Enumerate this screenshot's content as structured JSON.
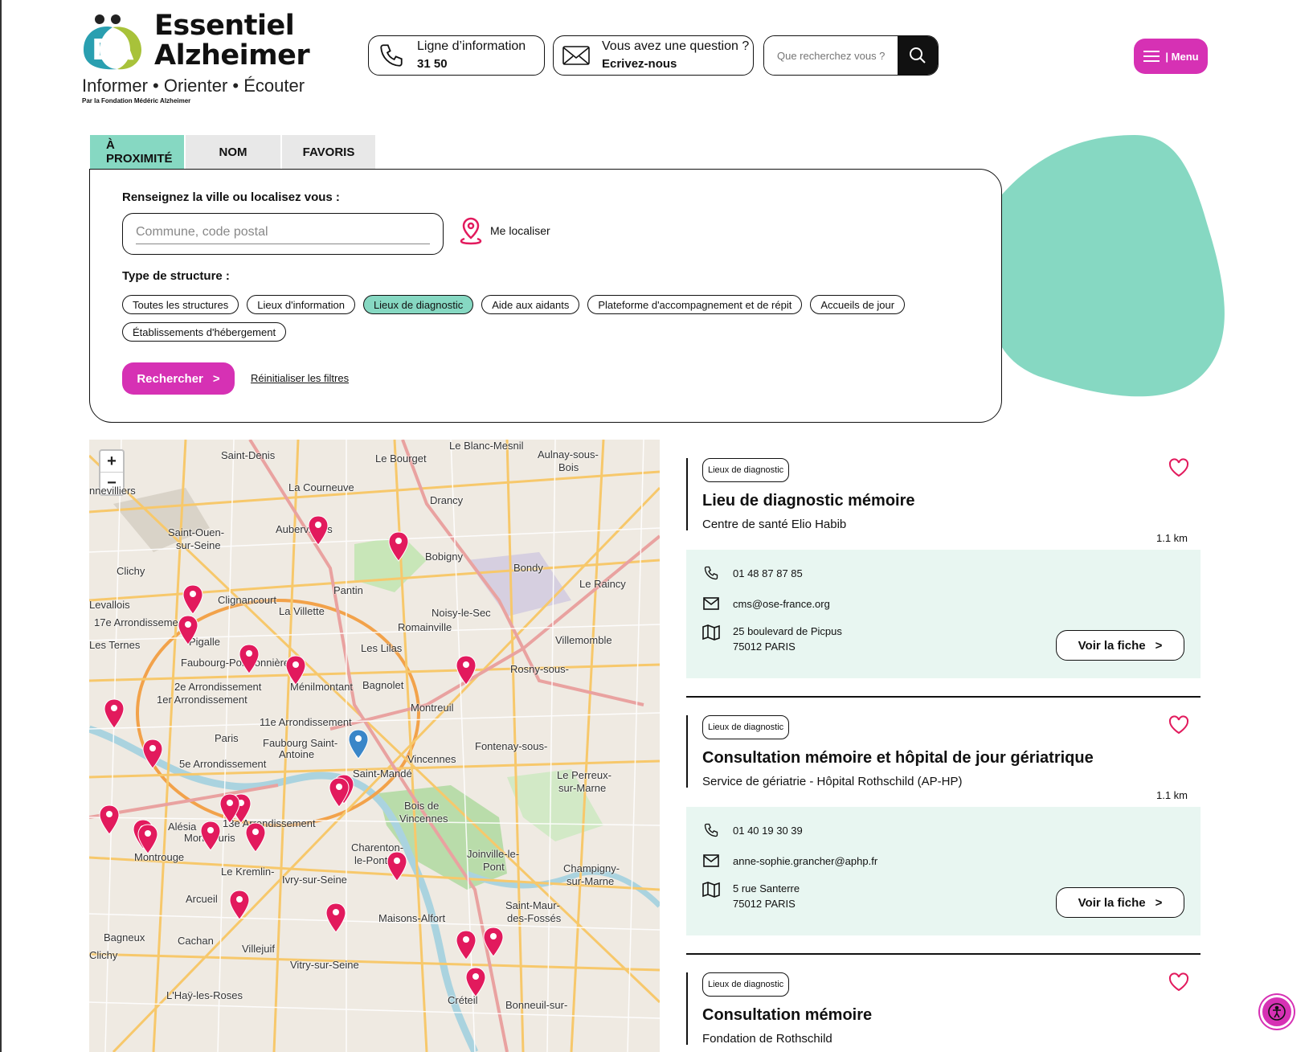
{
  "brand": {
    "title_line1": "Essentiel",
    "title_line2": "Alzheimer",
    "tagline": "Informer • Orienter • Écouter",
    "subline": "Par la Fondation Médéric Alzheimer",
    "colors": {
      "magenta": "#d631b4",
      "mint": "#86d8c2",
      "teal": "#2a9fb0",
      "green": "#a8c23a"
    }
  },
  "header": {
    "phone": {
      "line1": "Ligne d’information",
      "line2": "31 50",
      "icon": "phone-icon"
    },
    "contact": {
      "line1": "Vous avez une question ?",
      "line2": "Ecrivez-nous",
      "icon": "envelope-icon"
    },
    "search_placeholder": "Que recherchez vous ?",
    "menu_label": "| Menu"
  },
  "tabs": [
    "À PROXIMITÉ",
    "NOM",
    "FAVORIS"
  ],
  "form": {
    "city_label": "Renseignez la ville ou localisez vous :",
    "city_placeholder": "Commune, code postal",
    "locate_label": "Me localiser",
    "type_label": "Type de structure :",
    "chips": [
      {
        "label": "Toutes les structures",
        "active": false
      },
      {
        "label": "Lieux d'information",
        "active": false
      },
      {
        "label": "Lieux de diagnostic",
        "active": true
      },
      {
        "label": "Aide aux aidants",
        "active": false
      },
      {
        "label": "Plateforme d'accompagnement et de répit",
        "active": false
      },
      {
        "label": "Accueils de jour",
        "active": false
      },
      {
        "label": "Établissements d'hébergement",
        "active": false
      }
    ],
    "search_btn": "Rechercher",
    "reset_label": "Réinitialiser les filtres"
  },
  "map": {
    "zoom_in": "+",
    "zoom_out": "−",
    "places": [
      "Saint-Denis",
      "Le Blanc-Mesnil",
      "Aulnay-sous-",
      "Bois",
      "Le Bourget",
      "La Courneuve",
      "Drancy",
      "nnevilliers",
      "Aubervilliers",
      "Saint-Ouen-",
      "sur-Seine",
      "Bobigny",
      "Bondy",
      "Clichy",
      "Pantin",
      "Clignancourt",
      "La Villette",
      "Le Raincy",
      "17e Arrondissement",
      "Noisy-le-Sec",
      "Romainville",
      "Pigalle",
      "Les Lilas",
      "Villemomble",
      "Faubourg-Poissonnière",
      "Ménilmontant",
      "Bagnolet",
      "Rosny-sous-",
      "Montreuil",
      "2e Arrondissement",
      "1er Arrondissement",
      "11e Arrondissement",
      "Paris",
      "Faubourg Saint-",
      "Antoine",
      "Fontenay-sous-",
      "Vincennes",
      "5e Arrondissement",
      "Saint-Mandé",
      "Le Perreux-",
      "sur-Marne",
      "13e Arrondissement",
      "Alésia",
      "Bois de",
      "Vincennes",
      "Montsouris",
      "Charenton-",
      "le-Pont",
      "Joinville-le-",
      "Pont",
      "Montrouge",
      "Le Kremlin-",
      "Ivry-sur-Seine",
      "Champigny-",
      "sur-Marne",
      "Arcueil",
      "Maisons-Alfort",
      "Saint-Maur-",
      "des-Fossés",
      "Bagneux",
      "Cachan",
      "Villejuif",
      "Vitry-sur-Seine",
      "L'Haÿ-les-Roses",
      "Créteil",
      "Bonneuil-sur-",
      "Clichy",
      "Levallois",
      "Les Ternes"
    ]
  },
  "results": [
    {
      "badge": "Lieux de diagnostic",
      "title": "Lieu de diagnostic mémoire",
      "subtitle": "Centre de santé Elio Habib",
      "distance": "1.1 km",
      "phone": "01 48 87 87 85",
      "email": "cms@ose-france.org",
      "address1": "25 boulevard de Picpus",
      "address2": "75012 PARIS",
      "cta": "Voir la fiche"
    },
    {
      "badge": "Lieux de diagnostic",
      "title": "Consultation mémoire et hôpital de jour gériatrique",
      "subtitle": "Service de gériatrie - Hôpital Rothschild (AP-HP)",
      "distance": "1.1 km",
      "phone": "01 40 19 30 39",
      "email": "anne-sophie.grancher@aphp.fr",
      "address1": "5 rue Santerre",
      "address2": "75012 PARIS",
      "cta": "Voir la fiche"
    },
    {
      "badge": "Lieux de diagnostic",
      "title": "Consultation mémoire",
      "subtitle": "Fondation de Rothschild"
    }
  ]
}
